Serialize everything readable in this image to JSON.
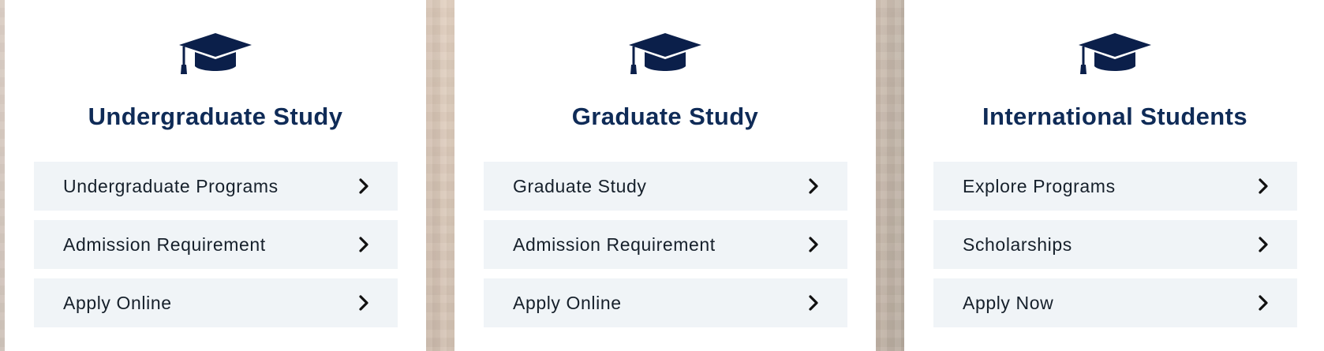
{
  "colors": {
    "title": "#0f2b57",
    "icon": "#0b1f4a",
    "link_bg": "#f0f4f7",
    "link_text": "#16202b"
  },
  "cards": [
    {
      "title": "Undergraduate Study",
      "icon": "graduation-cap-icon",
      "links": [
        {
          "label": "Undergraduate Programs",
          "icon": "chevron-right-icon"
        },
        {
          "label": "Admission Requirement",
          "icon": "chevron-right-icon"
        },
        {
          "label": "Apply Online",
          "icon": "chevron-right-icon"
        }
      ]
    },
    {
      "title": "Graduate Study",
      "icon": "graduation-cap-icon",
      "links": [
        {
          "label": "Graduate Study",
          "icon": "chevron-right-icon"
        },
        {
          "label": "Admission Requirement",
          "icon": "chevron-right-icon"
        },
        {
          "label": "Apply Online",
          "icon": "chevron-right-icon"
        }
      ]
    },
    {
      "title": "International Students",
      "icon": "graduation-cap-icon",
      "links": [
        {
          "label": "Explore Programs",
          "icon": "chevron-right-icon"
        },
        {
          "label": "Scholarships",
          "icon": "chevron-right-icon"
        },
        {
          "label": "Apply Now",
          "icon": "chevron-right-icon"
        }
      ]
    }
  ]
}
